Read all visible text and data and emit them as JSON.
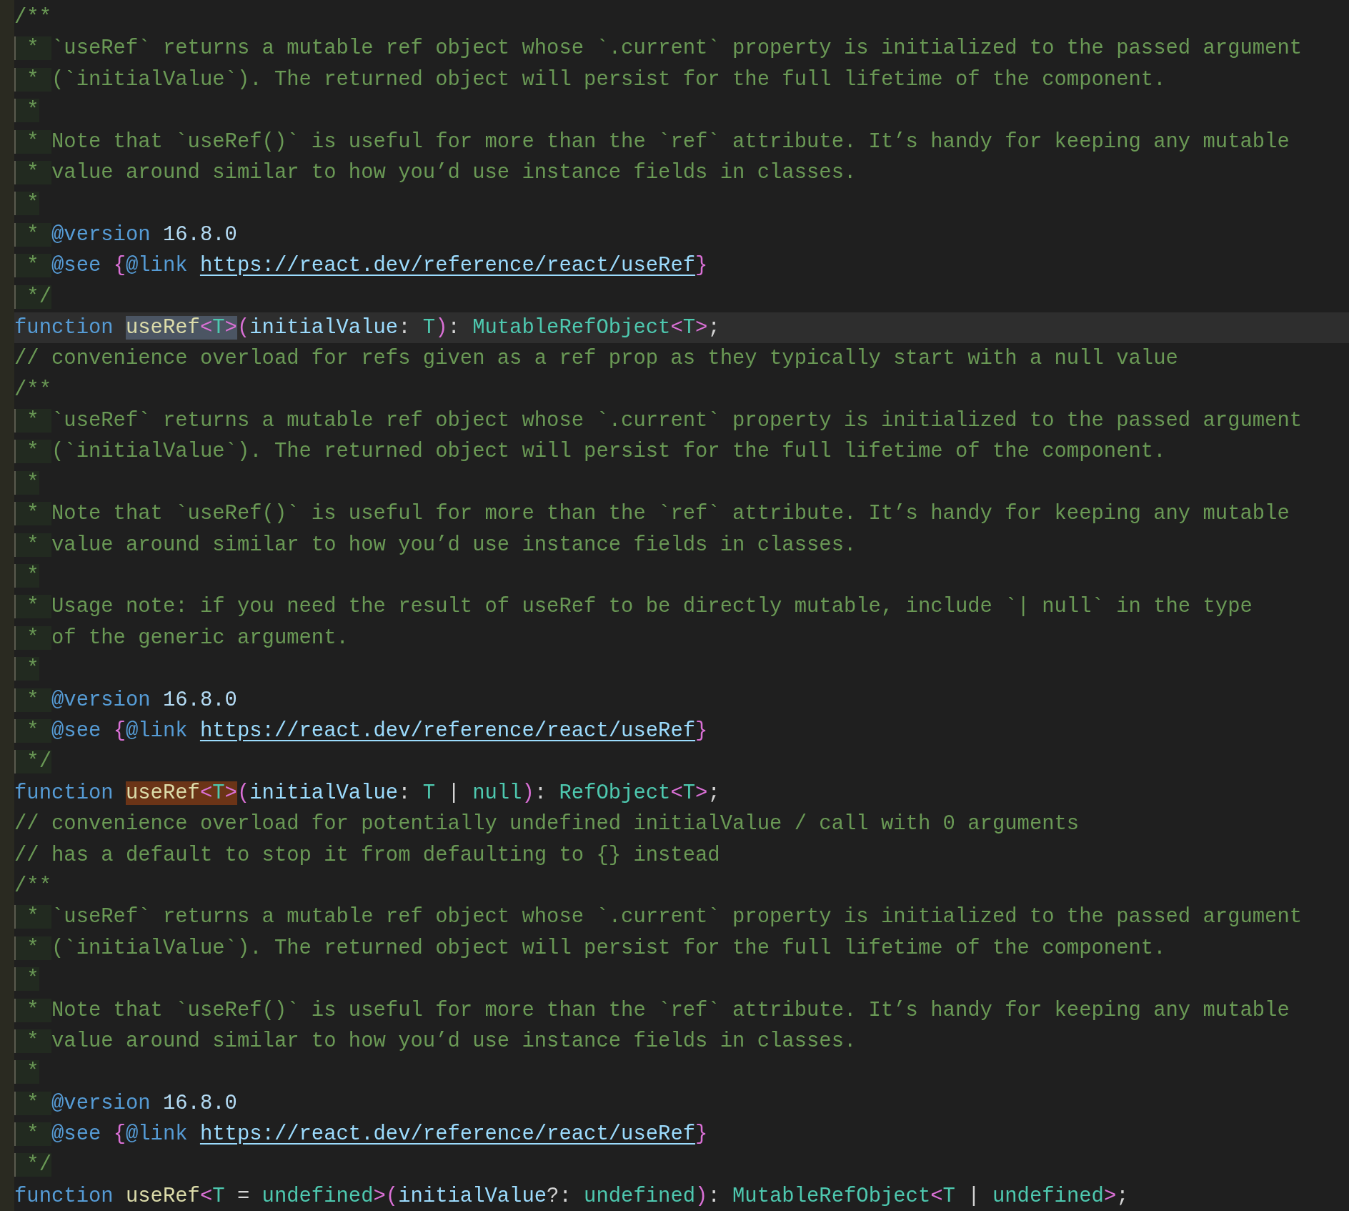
{
  "editor": {
    "lines": [
      {
        "kind": "plain",
        "current": false,
        "tokens": [
          {
            "text": "/**",
            "kind": "comment"
          }
        ]
      },
      {
        "kind": "doc",
        "current": false,
        "tokens": [
          {
            "text": " * ",
            "kind": "prefix"
          },
          {
            "text": "`useRef` returns a mutable ref object whose `.current` property is initialized to the passed argument",
            "kind": "comment"
          }
        ]
      },
      {
        "kind": "doc",
        "current": false,
        "tokens": [
          {
            "text": " * ",
            "kind": "prefix"
          },
          {
            "text": "(`initialValue`). The returned object will persist for the full lifetime of the component.",
            "kind": "comment"
          }
        ]
      },
      {
        "kind": "doc",
        "current": false,
        "tokens": [
          {
            "text": " *",
            "kind": "prefix"
          }
        ]
      },
      {
        "kind": "doc",
        "current": false,
        "tokens": [
          {
            "text": " * ",
            "kind": "prefix"
          },
          {
            "text": "Note that `useRef()` is useful for more than the `ref` attribute. It’s handy for keeping any mutable",
            "kind": "comment"
          }
        ]
      },
      {
        "kind": "doc",
        "current": false,
        "tokens": [
          {
            "text": " * ",
            "kind": "prefix"
          },
          {
            "text": "value around similar to how you’d use instance fields in classes.",
            "kind": "comment"
          }
        ]
      },
      {
        "kind": "doc",
        "current": false,
        "tokens": [
          {
            "text": " *",
            "kind": "prefix"
          }
        ]
      },
      {
        "kind": "doc",
        "current": false,
        "tokens": [
          {
            "text": " * ",
            "kind": "prefix"
          },
          {
            "text": "@version ",
            "kind": "tag"
          },
          {
            "text": "16.8.0",
            "kind": "number"
          }
        ]
      },
      {
        "kind": "doc",
        "current": false,
        "tokens": [
          {
            "text": " * ",
            "kind": "prefix"
          },
          {
            "text": "@see ",
            "kind": "tag"
          },
          {
            "text": "{",
            "kind": "brace"
          },
          {
            "text": "@link ",
            "kind": "tag"
          },
          {
            "text": "https://react.dev/reference/react/useRef",
            "kind": "link"
          },
          {
            "text": "}",
            "kind": "brace"
          }
        ]
      },
      {
        "kind": "doc",
        "current": false,
        "tokens": [
          {
            "text": " */",
            "kind": "prefix"
          }
        ]
      },
      {
        "kind": "plain",
        "current": true,
        "tokens": [
          {
            "text": "function ",
            "kind": "keyword"
          },
          {
            "text": "useRef",
            "kind": "function",
            "highlighted": true
          },
          {
            "text": "<",
            "kind": "bracket",
            "highlighted": true
          },
          {
            "text": "T",
            "kind": "type",
            "highlighted": true
          },
          {
            "text": ">",
            "kind": "bracket",
            "highlighted": true
          },
          {
            "text": "(",
            "kind": "bracket"
          },
          {
            "text": "initialValue",
            "kind": "param"
          },
          {
            "text": ": ",
            "kind": "punct"
          },
          {
            "text": "T",
            "kind": "type"
          },
          {
            "text": ")",
            "kind": "bracket"
          },
          {
            "text": ": ",
            "kind": "punct"
          },
          {
            "text": "MutableRefObject",
            "kind": "type"
          },
          {
            "text": "<",
            "kind": "bracket"
          },
          {
            "text": "T",
            "kind": "type"
          },
          {
            "text": ">",
            "kind": "bracket"
          },
          {
            "text": ";",
            "kind": "punct"
          }
        ]
      },
      {
        "kind": "plain",
        "current": false,
        "tokens": [
          {
            "text": "// convenience overload for refs given as a ref prop as they typically start with a null value",
            "kind": "comment"
          }
        ]
      },
      {
        "kind": "plain",
        "current": false,
        "tokens": [
          {
            "text": "/**",
            "kind": "comment"
          }
        ]
      },
      {
        "kind": "doc",
        "current": false,
        "tokens": [
          {
            "text": " * ",
            "kind": "prefix"
          },
          {
            "text": "`useRef` returns a mutable ref object whose `.current` property is initialized to the passed argument",
            "kind": "comment"
          }
        ]
      },
      {
        "kind": "doc",
        "current": false,
        "tokens": [
          {
            "text": " * ",
            "kind": "prefix"
          },
          {
            "text": "(`initialValue`). The returned object will persist for the full lifetime of the component.",
            "kind": "comment"
          }
        ]
      },
      {
        "kind": "doc",
        "current": false,
        "tokens": [
          {
            "text": " *",
            "kind": "prefix"
          }
        ]
      },
      {
        "kind": "doc",
        "current": false,
        "tokens": [
          {
            "text": " * ",
            "kind": "prefix"
          },
          {
            "text": "Note that `useRef()` is useful for more than the `ref` attribute. It’s handy for keeping any mutable",
            "kind": "comment"
          }
        ]
      },
      {
        "kind": "doc",
        "current": false,
        "tokens": [
          {
            "text": " * ",
            "kind": "prefix"
          },
          {
            "text": "value around similar to how you’d use instance fields in classes.",
            "kind": "comment"
          }
        ]
      },
      {
        "kind": "doc",
        "current": false,
        "tokens": [
          {
            "text": " *",
            "kind": "prefix"
          }
        ]
      },
      {
        "kind": "doc",
        "current": false,
        "tokens": [
          {
            "text": " * ",
            "kind": "prefix"
          },
          {
            "text": "Usage note: if you need the result of useRef to be directly mutable, include `| null` in the type",
            "kind": "comment"
          }
        ]
      },
      {
        "kind": "doc",
        "current": false,
        "tokens": [
          {
            "text": " * ",
            "kind": "prefix"
          },
          {
            "text": "of the generic argument.",
            "kind": "comment"
          }
        ]
      },
      {
        "kind": "doc",
        "current": false,
        "tokens": [
          {
            "text": " *",
            "kind": "prefix"
          }
        ]
      },
      {
        "kind": "doc",
        "current": false,
        "tokens": [
          {
            "text": " * ",
            "kind": "prefix"
          },
          {
            "text": "@version ",
            "kind": "tag"
          },
          {
            "text": "16.8.0",
            "kind": "number"
          }
        ]
      },
      {
        "kind": "doc",
        "current": false,
        "tokens": [
          {
            "text": " * ",
            "kind": "prefix"
          },
          {
            "text": "@see ",
            "kind": "tag"
          },
          {
            "text": "{",
            "kind": "brace"
          },
          {
            "text": "@link ",
            "kind": "tag"
          },
          {
            "text": "https://react.dev/reference/react/useRef",
            "kind": "link"
          },
          {
            "text": "}",
            "kind": "brace"
          }
        ]
      },
      {
        "kind": "doc",
        "current": false,
        "tokens": [
          {
            "text": " */",
            "kind": "prefix"
          }
        ]
      },
      {
        "kind": "plain",
        "current": false,
        "tokens": [
          {
            "text": "function ",
            "kind": "keyword"
          },
          {
            "text": "useRef",
            "kind": "function",
            "highlighted": true
          },
          {
            "text": "<",
            "kind": "bracket",
            "highlighted": true
          },
          {
            "text": "T",
            "kind": "type",
            "highlighted": true
          },
          {
            "text": ">",
            "kind": "bracket",
            "highlighted": true
          },
          {
            "text": "(",
            "kind": "bracket"
          },
          {
            "text": "initialValue",
            "kind": "param"
          },
          {
            "text": ": ",
            "kind": "punct"
          },
          {
            "text": "T",
            "kind": "type"
          },
          {
            "text": " | ",
            "kind": "punct"
          },
          {
            "text": "null",
            "kind": "type"
          },
          {
            "text": ")",
            "kind": "bracket"
          },
          {
            "text": ": ",
            "kind": "punct"
          },
          {
            "text": "RefObject",
            "kind": "type"
          },
          {
            "text": "<",
            "kind": "bracket"
          },
          {
            "text": "T",
            "kind": "type"
          },
          {
            "text": ">",
            "kind": "bracket"
          },
          {
            "text": ";",
            "kind": "punct"
          }
        ]
      },
      {
        "kind": "plain",
        "current": false,
        "tokens": [
          {
            "text": "// convenience overload for potentially undefined initialValue / call with 0 arguments",
            "kind": "comment"
          }
        ]
      },
      {
        "kind": "plain",
        "current": false,
        "tokens": [
          {
            "text": "// has a default to stop it from defaulting to {} instead",
            "kind": "comment"
          }
        ]
      },
      {
        "kind": "plain",
        "current": false,
        "tokens": [
          {
            "text": "/**",
            "kind": "comment"
          }
        ]
      },
      {
        "kind": "doc",
        "current": false,
        "tokens": [
          {
            "text": " * ",
            "kind": "prefix"
          },
          {
            "text": "`useRef` returns a mutable ref object whose `.current` property is initialized to the passed argument",
            "kind": "comment"
          }
        ]
      },
      {
        "kind": "doc",
        "current": false,
        "tokens": [
          {
            "text": " * ",
            "kind": "prefix"
          },
          {
            "text": "(`initialValue`). The returned object will persist for the full lifetime of the component.",
            "kind": "comment"
          }
        ]
      },
      {
        "kind": "doc",
        "current": false,
        "tokens": [
          {
            "text": " *",
            "kind": "prefix"
          }
        ]
      },
      {
        "kind": "doc",
        "current": false,
        "tokens": [
          {
            "text": " * ",
            "kind": "prefix"
          },
          {
            "text": "Note that `useRef()` is useful for more than the `ref` attribute. It’s handy for keeping any mutable",
            "kind": "comment"
          }
        ]
      },
      {
        "kind": "doc",
        "current": false,
        "tokens": [
          {
            "text": " * ",
            "kind": "prefix"
          },
          {
            "text": "value around similar to how you’d use instance fields in classes.",
            "kind": "comment"
          }
        ]
      },
      {
        "kind": "doc",
        "current": false,
        "tokens": [
          {
            "text": " *",
            "kind": "prefix"
          }
        ]
      },
      {
        "kind": "doc",
        "current": false,
        "tokens": [
          {
            "text": " * ",
            "kind": "prefix"
          },
          {
            "text": "@version ",
            "kind": "tag"
          },
          {
            "text": "16.8.0",
            "kind": "number"
          }
        ]
      },
      {
        "kind": "doc",
        "current": false,
        "tokens": [
          {
            "text": " * ",
            "kind": "prefix"
          },
          {
            "text": "@see ",
            "kind": "tag"
          },
          {
            "text": "{",
            "kind": "brace"
          },
          {
            "text": "@link ",
            "kind": "tag"
          },
          {
            "text": "https://react.dev/reference/react/useRef",
            "kind": "link"
          },
          {
            "text": "}",
            "kind": "brace"
          }
        ]
      },
      {
        "kind": "doc",
        "current": false,
        "tokens": [
          {
            "text": " */",
            "kind": "prefix"
          }
        ]
      },
      {
        "kind": "plain",
        "current": false,
        "tokens": [
          {
            "text": "function ",
            "kind": "keyword"
          },
          {
            "text": "useRef",
            "kind": "function"
          },
          {
            "text": "<",
            "kind": "bracket"
          },
          {
            "text": "T",
            "kind": "type"
          },
          {
            "text": " = ",
            "kind": "punct"
          },
          {
            "text": "undefined",
            "kind": "type"
          },
          {
            "text": ">",
            "kind": "bracket"
          },
          {
            "text": "(",
            "kind": "bracket"
          },
          {
            "text": "initialValue",
            "kind": "param"
          },
          {
            "text": "?: ",
            "kind": "punct"
          },
          {
            "text": "undefined",
            "kind": "type"
          },
          {
            "text": ")",
            "kind": "bracket"
          },
          {
            "text": ": ",
            "kind": "punct"
          },
          {
            "text": "MutableRefObject",
            "kind": "type"
          },
          {
            "text": "<",
            "kind": "bracket"
          },
          {
            "text": "T",
            "kind": "type"
          },
          {
            "text": " | ",
            "kind": "punct"
          },
          {
            "text": "undefined",
            "kind": "type"
          },
          {
            "text": ">",
            "kind": "bracket"
          },
          {
            "text": ";",
            "kind": "punct"
          }
        ]
      }
    ]
  }
}
